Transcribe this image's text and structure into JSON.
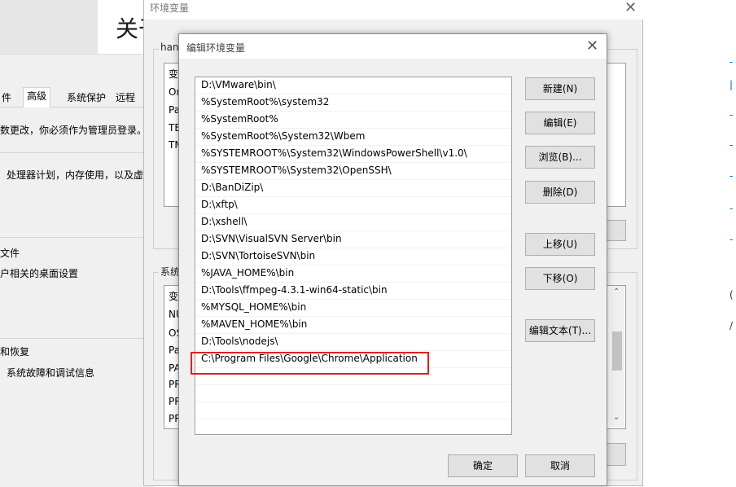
{
  "settings_page": {
    "about_title": "关于"
  },
  "system_properties": {
    "tabs": [
      {
        "label": "件"
      },
      {
        "label": "高级"
      },
      {
        "label": "系统保护"
      },
      {
        "label": "远程"
      }
    ],
    "admin_notice": "数更改，你必须作为管理员登录。",
    "performance_desc": "处理器计划，内存使用，以及虚",
    "profiles_heading": "文件",
    "profiles_desc": "户相关的桌面设置",
    "startup_heading": "和恢复",
    "startup_desc": "系统故障和调试信息"
  },
  "env_dialog": {
    "title": "环境变量",
    "user_group_label": "hany",
    "user_rows": [
      "变",
      "On",
      "Pa",
      "TE",
      "TM"
    ],
    "system_group_label": "系统",
    "system_rows": [
      "变",
      "NU",
      "OS",
      "Pa",
      "PA",
      "PR",
      "PR",
      "PR"
    ]
  },
  "edit_dialog": {
    "title": "编辑环境变量",
    "paths": [
      "D:\\VMware\\bin\\",
      "%SystemRoot%\\system32",
      "%SystemRoot%",
      "%SystemRoot%\\System32\\Wbem",
      "%SYSTEMROOT%\\System32\\WindowsPowerShell\\v1.0\\",
      "%SYSTEMROOT%\\System32\\OpenSSH\\",
      "D:\\BanDiZip\\",
      "D:\\xftp\\",
      "D:\\xshell\\",
      "D:\\SVN\\VisualSVN Server\\bin",
      "D:\\SVN\\TortoiseSVN\\bin",
      "%JAVA_HOME%\\bin",
      "D:\\Tools\\ffmpeg-4.3.1-win64-static\\bin",
      "%MYSQL_HOME%\\bin",
      "%MAVEN_HOME%\\bin",
      "D:\\Tools\\nodejs\\",
      "C:\\Program Files\\Google\\Chrome\\Application"
    ],
    "highlighted_index": 16,
    "highlight_color": "#e02020",
    "buttons": {
      "new": "新建(N)",
      "edit": "编辑(E)",
      "browse": "浏览(B)...",
      "delete": "删除(D)",
      "move_up": "上移(U)",
      "move_down": "下移(O)",
      "edit_text": "编辑文本(T)...",
      "ok": "确定",
      "cancel": "取消"
    }
  }
}
